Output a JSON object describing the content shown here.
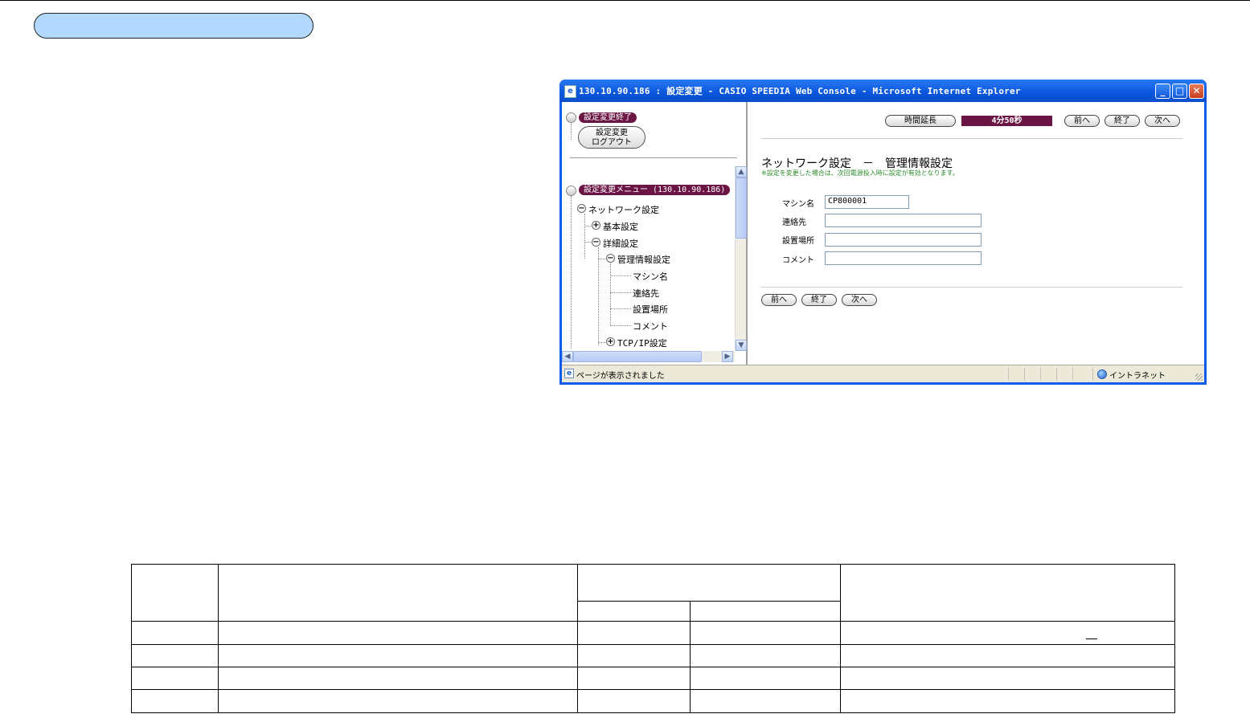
{
  "window": {
    "title": "130.10.90.186 : 設定変更 - CASIO SPEEDIA Web Console - Microsoft Internet Explorer",
    "controls": {
      "minimize": "_",
      "maximize": "□",
      "close": "✕"
    }
  },
  "left_frame": {
    "end_label": "設定変更終了",
    "logout_button": {
      "line1": "設定変更",
      "line2": "ログアウト"
    },
    "menu_label": "設定変更メニュー (130.10.90.186)",
    "tree": {
      "network": "ネットワーク設定",
      "basic": "基本設定",
      "advanced": "詳細設定",
      "admin_info": "管理情報設定",
      "machine_name": "マシン名",
      "contact": "連絡先",
      "location": "設置場所",
      "comment": "コメント",
      "tcpip": "TCP/IP設定"
    }
  },
  "right_frame": {
    "extend_button": "時間延長",
    "timer": "4分50秒",
    "prev_button": "前へ",
    "end_button": "終了",
    "next_button": "次へ",
    "heading": "ネットワーク設定　－　管理情報設定",
    "notice": "※設定を変更した場合は、次回電源投入時に設定が有効となります。",
    "fields": {
      "machine_name": {
        "label": "マシン名",
        "value": "CP800001"
      },
      "contact": {
        "label": "連絡先",
        "value": ""
      },
      "location": {
        "label": "設置場所",
        "value": ""
      },
      "comment": {
        "label": "コメント",
        "value": ""
      }
    }
  },
  "status_bar": {
    "text": "ページが表示されました",
    "zone": "イントラネット"
  },
  "colors": {
    "section_pill": "#b3d8ff",
    "menu_pill": "#6b1544",
    "titlebar": "#0a55dc",
    "notice": "#2a8a2a"
  }
}
